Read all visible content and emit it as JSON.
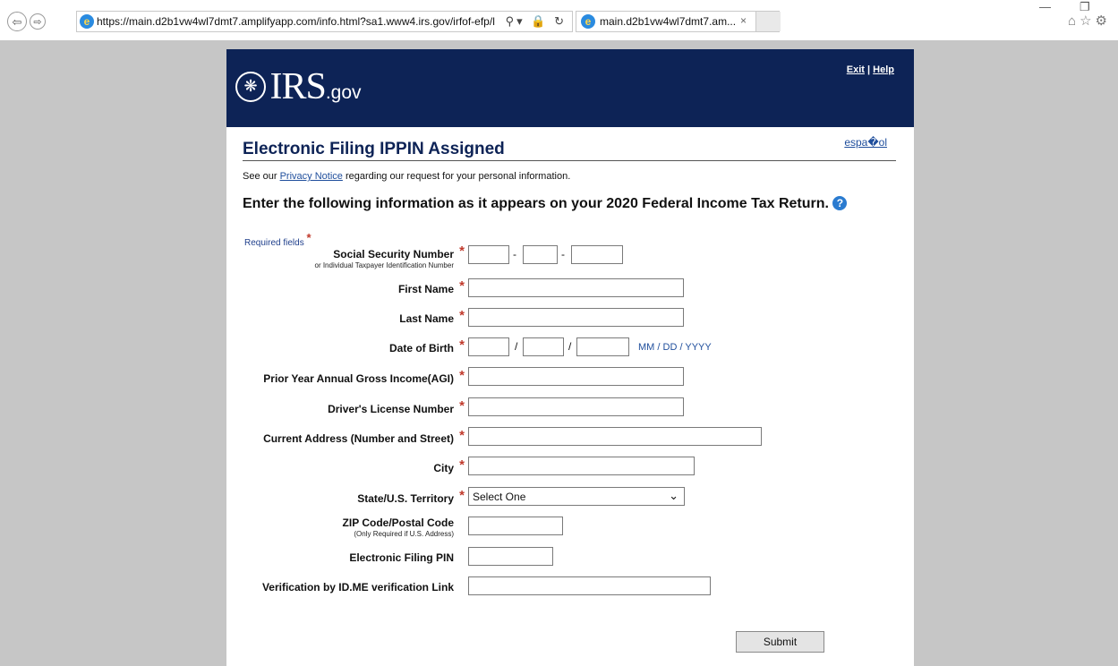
{
  "browser": {
    "url": "https://main.d2b1vw4wl7dmt7.amplifyapp.com/info.html?sa1.www4.irs.gov/irfof-efp/lo",
    "tab_title": "main.d2b1vw4wl7dmt7.am...",
    "tab_close": "×"
  },
  "header": {
    "logo_main": "IRS",
    "logo_suffix": ".gov",
    "exit_label": "Exit",
    "link_separator": "|",
    "help_label": "Help"
  },
  "page": {
    "title": "Electronic Filing IPPIN Assigned",
    "language_link": "espa�ol",
    "privacy_prefix": "See our ",
    "privacy_link": "Privacy Notice",
    "privacy_suffix": " regarding our request for your personal information.",
    "instruction": "Enter the following information as it appears on your 2020 Federal Income Tax Return.",
    "help_glyph": "?",
    "required_label": "Required fields"
  },
  "form": {
    "ssn_label": "Social Security Number",
    "ssn_sublabel": "or Individual Taxpayer Identification Number",
    "ssn_sep": "-",
    "first_name_label": "First Name",
    "last_name_label": "Last Name",
    "dob_label": "Date of Birth",
    "dob_sep": "/",
    "dob_hint": "MM / DD / YYYY",
    "agi_label": "Prior Year Annual Gross Income(AGI)",
    "license_label": "Driver's License Number",
    "address_label": "Current Address (Number and Street)",
    "city_label": "City",
    "state_label": "State/U.S. Territory",
    "state_value": "Select One",
    "zip_label": "ZIP Code/Postal Code",
    "zip_sublabel": "(Only Required if U.S. Address)",
    "efile_pin_label": "Electronic Filing PIN",
    "idme_label": "Verification by ID.ME verification Link",
    "submit_label": "Submit",
    "required_star": "*"
  }
}
